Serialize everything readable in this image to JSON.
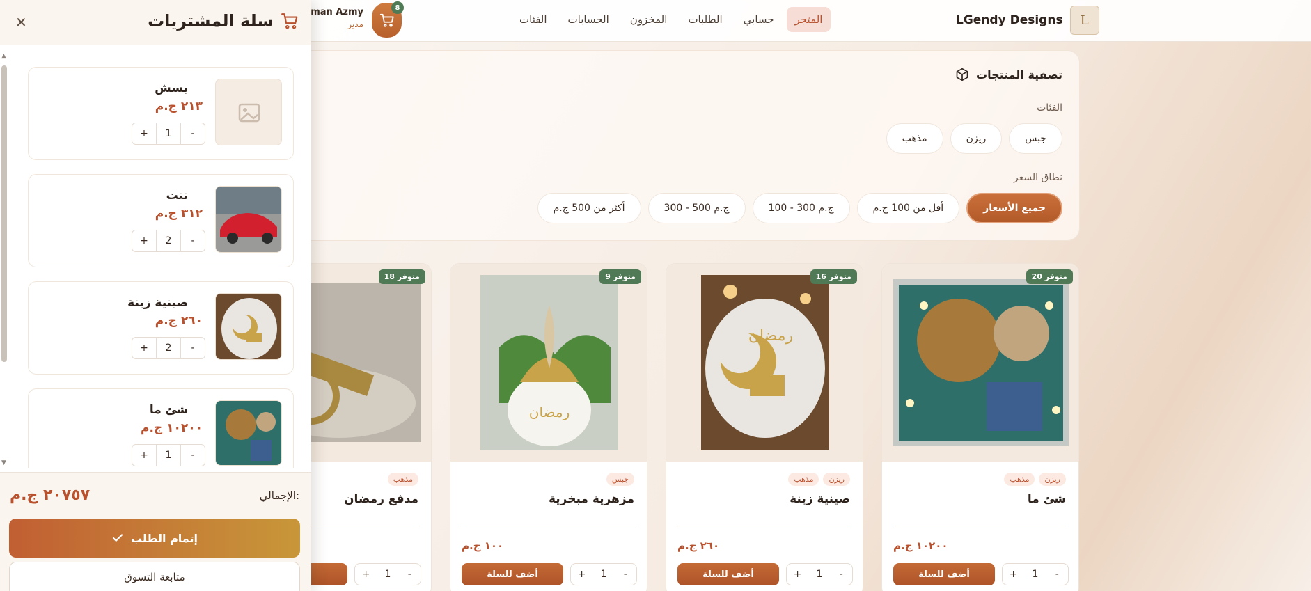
{
  "header": {
    "brand": "LGendy Designs",
    "nav": [
      {
        "label": "المتجر",
        "active": true
      },
      {
        "label": "حسابي",
        "active": false
      },
      {
        "label": "الطلبات",
        "active": false
      },
      {
        "label": "المخزون",
        "active": false
      },
      {
        "label": "الحسابات",
        "active": false
      },
      {
        "label": "الفئات",
        "active": false
      }
    ],
    "user_name": "hman Azmy",
    "user_role": "مدير",
    "cart_count": "8"
  },
  "filter": {
    "title": "تصفية المنتجات",
    "categories_label": "الفئات",
    "categories": [
      "جبس",
      "ريزن",
      "مذهب"
    ],
    "price_label": "نطاق السعر",
    "price_ranges": [
      "جميع الأسعار",
      "أقل من 100 ج.م",
      "100 - 300 ج.م",
      "300 - 500 ج.م",
      "أكثر من 500 ج.م"
    ]
  },
  "products": [
    {
      "stock": "متوفر 20",
      "tags": [
        "ريزن",
        "مذهب"
      ],
      "name": "شئ ما",
      "price": "١٠٢٠٠ ج.م",
      "add_label": "أضف للسلة",
      "qty": "1"
    },
    {
      "stock": "متوفر 16",
      "tags": [
        "ريزن",
        "مذهب"
      ],
      "name": "صينية زينة",
      "price": "٢٦٠ ج.م",
      "add_label": "أضف للسلة",
      "qty": "1"
    },
    {
      "stock": "متوفر 9",
      "tags": [
        "جبس"
      ],
      "name": "مزهرية مبخرية",
      "price": "١٠٠ ج.م",
      "add_label": "أضف للسلة",
      "qty": "1"
    },
    {
      "stock": "متوفر 18",
      "tags": [
        "مذهب"
      ],
      "name": "مدفع رمضان",
      "price": "",
      "add_label": "أض",
      "qty": "1"
    }
  ],
  "cart": {
    "title": "سلة المشتريات",
    "items": [
      {
        "name": "يسش",
        "price": "٢١٣ ج.م",
        "qty": "1"
      },
      {
        "name": "تتت",
        "price": "٣١٢ ج.م",
        "qty": "2"
      },
      {
        "name": "صينية زينة",
        "price": "٢٦٠ ج.م",
        "qty": "2"
      },
      {
        "name": "شئ ما",
        "price": "١٠٢٠٠ ج.م",
        "qty": "1"
      }
    ],
    "total_label": "الإجمالي:",
    "total_value": "٢٠٧٥٧ ج.م",
    "checkout_label": "إتمام الطلب",
    "continue_label": "متابعة التسوق"
  },
  "colors": {
    "accent": "#b8512e",
    "stock_badge": "#4f7a55",
    "brand_gradient_start": "#c15f33",
    "brand_gradient_end": "#c89739"
  }
}
